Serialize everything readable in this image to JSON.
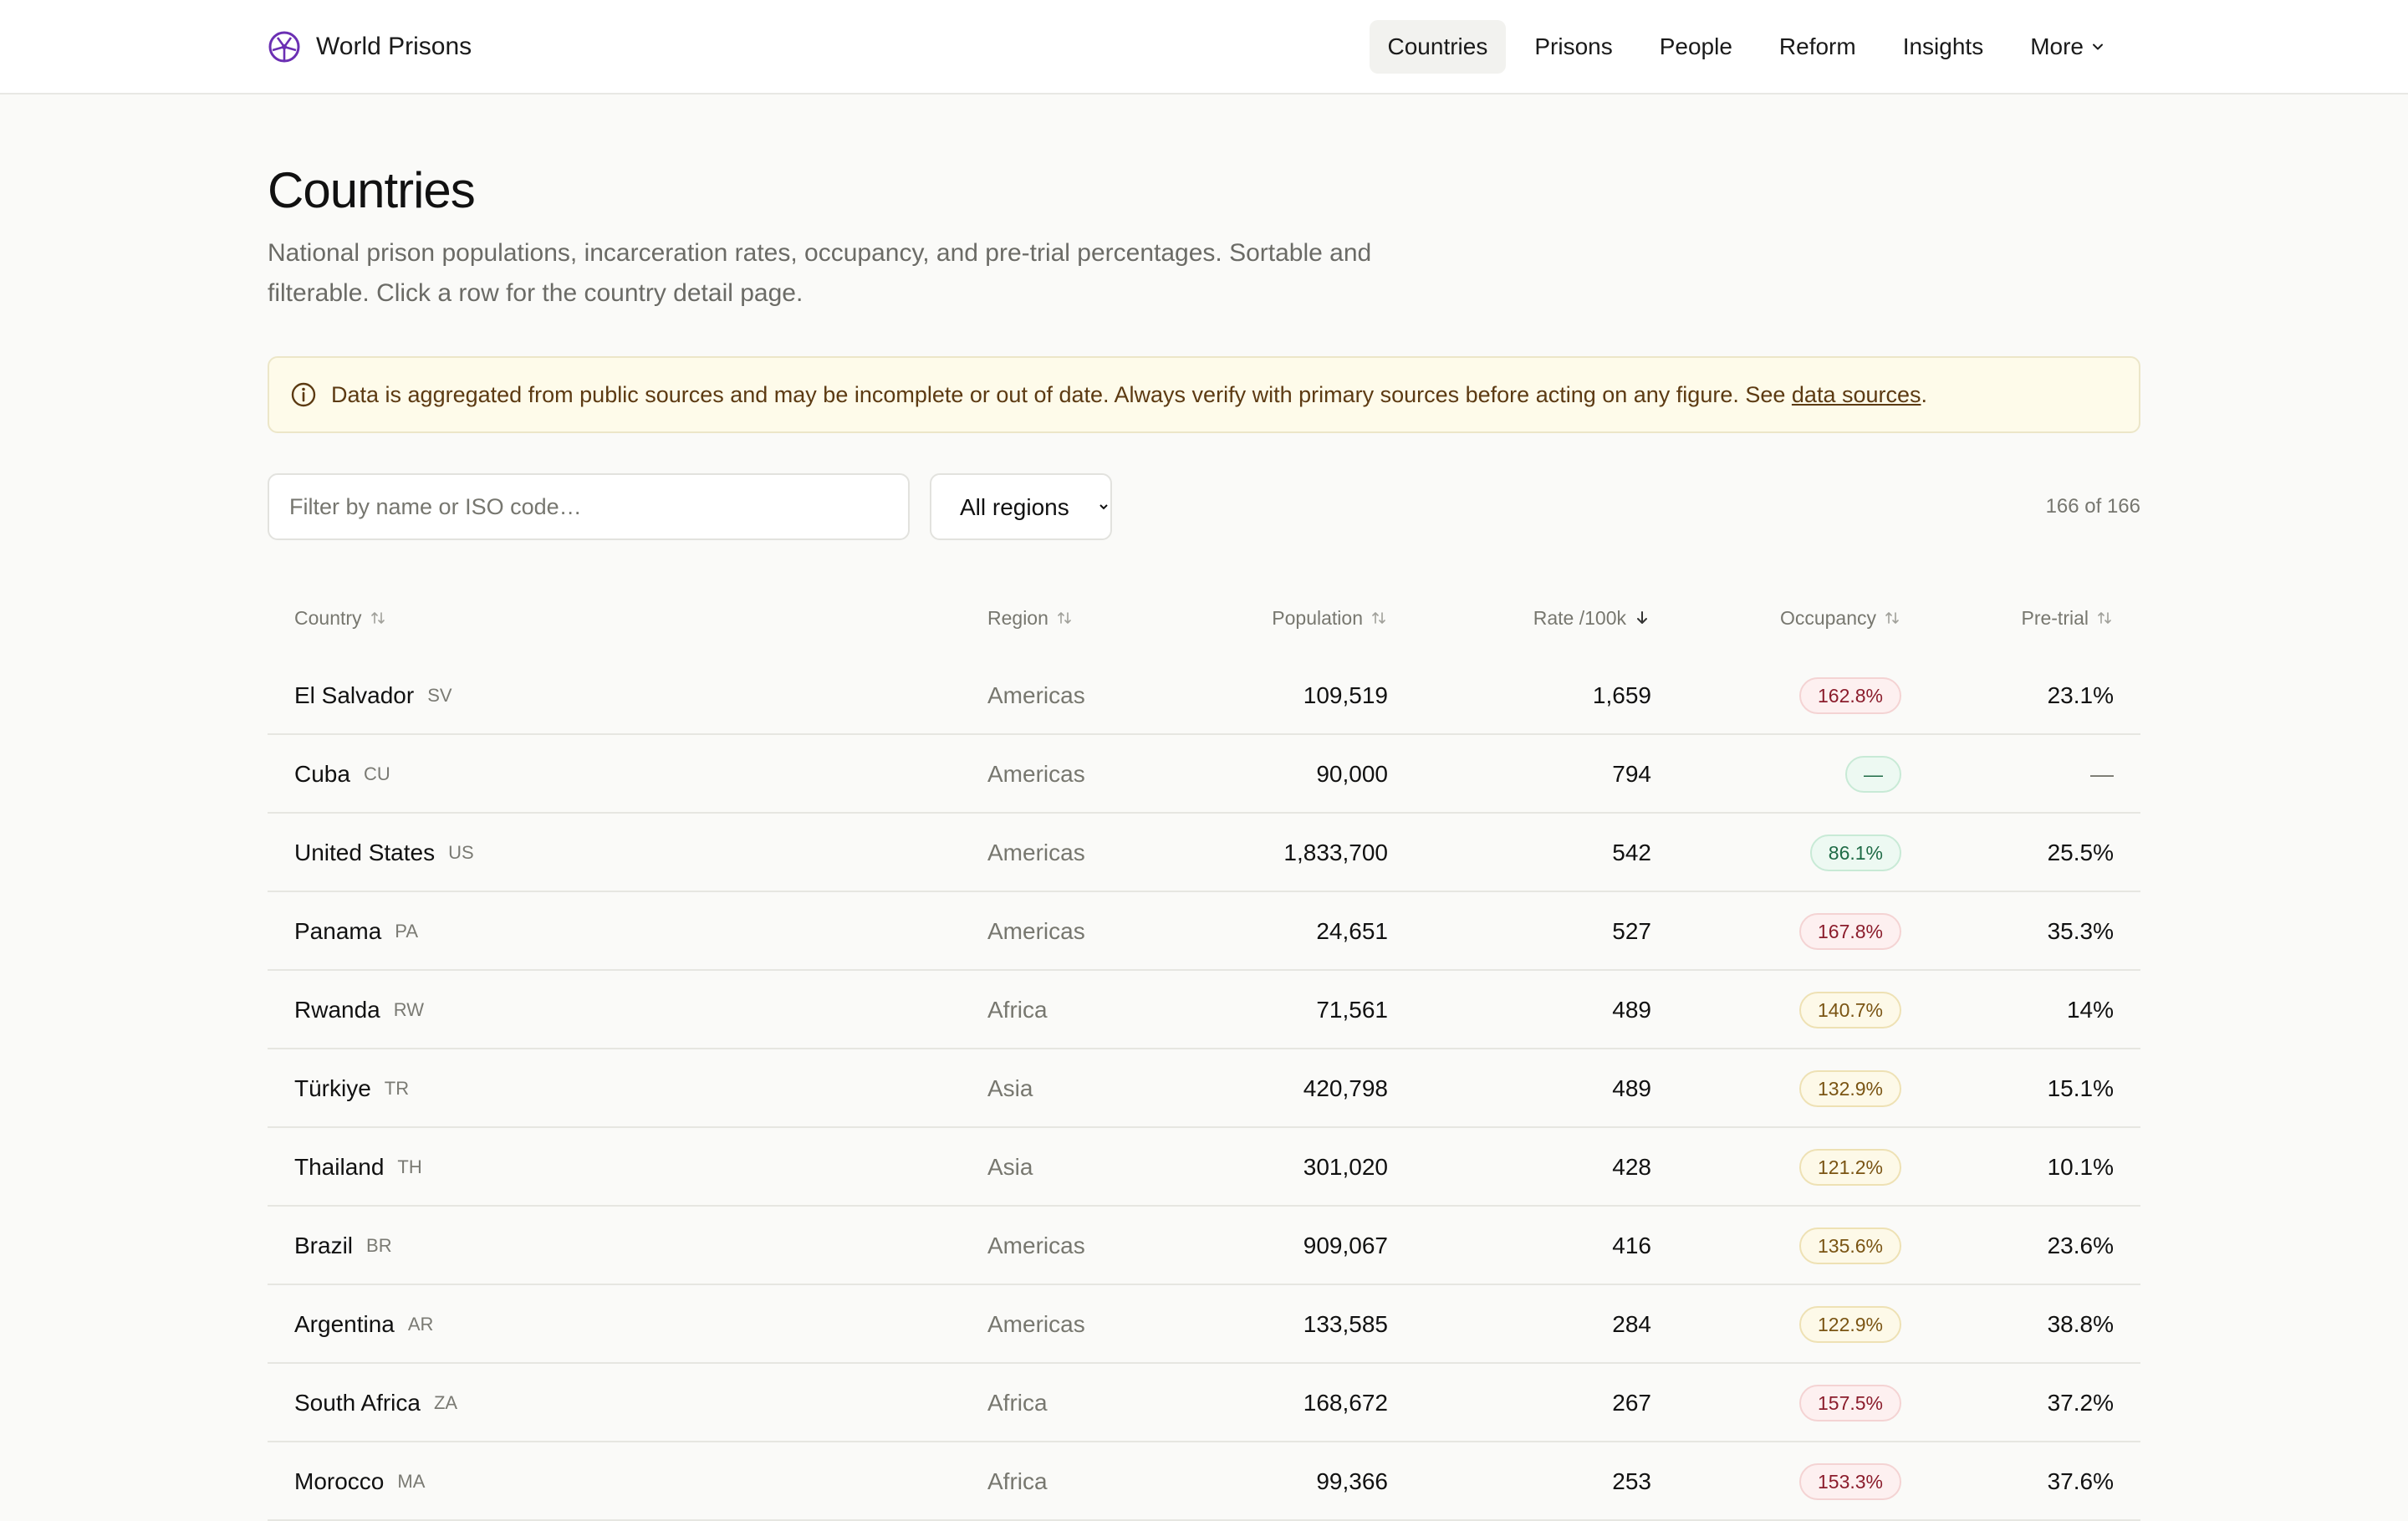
{
  "header": {
    "brand": "World Prisons",
    "nav": [
      {
        "label": "Countries",
        "active": true
      },
      {
        "label": "Prisons"
      },
      {
        "label": "People"
      },
      {
        "label": "Reform"
      },
      {
        "label": "Insights"
      },
      {
        "label": "More",
        "has_chevron": true
      }
    ]
  },
  "page": {
    "title": "Countries",
    "subtitle": "National prison populations, incarceration rates, occupancy, and pre-trial percentages. Sortable and filterable. Click a row for the country detail page."
  },
  "notice": {
    "text": "Data is aggregated from public sources and may be incomplete or out of date. Always verify with primary sources before acting on any figure. See ",
    "link": "data sources",
    "suffix": "."
  },
  "controls": {
    "filter_placeholder": "Filter by name or ISO code…",
    "region_selected": "All regions",
    "count": "166 of 166"
  },
  "table": {
    "columns": {
      "country": "Country",
      "region": "Region",
      "population": "Population",
      "rate": "Rate /100k",
      "occupancy": "Occupancy",
      "pretrial": "Pre-trial"
    },
    "rows": [
      {
        "country": "El Salvador",
        "iso": "SV",
        "region": "Americas",
        "population": "109,519",
        "rate": "1,659",
        "occupancy": "162.8%",
        "occ_level": "red",
        "pretrial": "23.1%"
      },
      {
        "country": "Cuba",
        "iso": "CU",
        "region": "Americas",
        "population": "90,000",
        "rate": "794",
        "occupancy": "—",
        "occ_level": "green",
        "pretrial": "—"
      },
      {
        "country": "United States",
        "iso": "US",
        "region": "Americas",
        "population": "1,833,700",
        "rate": "542",
        "occupancy": "86.1%",
        "occ_level": "green",
        "pretrial": "25.5%"
      },
      {
        "country": "Panama",
        "iso": "PA",
        "region": "Americas",
        "population": "24,651",
        "rate": "527",
        "occupancy": "167.8%",
        "occ_level": "red",
        "pretrial": "35.3%"
      },
      {
        "country": "Rwanda",
        "iso": "RW",
        "region": "Africa",
        "population": "71,561",
        "rate": "489",
        "occupancy": "140.7%",
        "occ_level": "amber",
        "pretrial": "14%"
      },
      {
        "country": "Türkiye",
        "iso": "TR",
        "region": "Asia",
        "population": "420,798",
        "rate": "489",
        "occupancy": "132.9%",
        "occ_level": "amber",
        "pretrial": "15.1%"
      },
      {
        "country": "Thailand",
        "iso": "TH",
        "region": "Asia",
        "population": "301,020",
        "rate": "428",
        "occupancy": "121.2%",
        "occ_level": "amber",
        "pretrial": "10.1%"
      },
      {
        "country": "Brazil",
        "iso": "BR",
        "region": "Americas",
        "population": "909,067",
        "rate": "416",
        "occupancy": "135.6%",
        "occ_level": "amber",
        "pretrial": "23.6%"
      },
      {
        "country": "Argentina",
        "iso": "AR",
        "region": "Americas",
        "population": "133,585",
        "rate": "284",
        "occupancy": "122.9%",
        "occ_level": "amber",
        "pretrial": "38.8%"
      },
      {
        "country": "South Africa",
        "iso": "ZA",
        "region": "Africa",
        "population": "168,672",
        "rate": "267",
        "occupancy": "157.5%",
        "occ_level": "red",
        "pretrial": "37.2%"
      },
      {
        "country": "Morocco",
        "iso": "MA",
        "region": "Africa",
        "population": "99,366",
        "rate": "253",
        "occupancy": "153.3%",
        "occ_level": "red",
        "pretrial": "37.6%"
      }
    ]
  },
  "colors": {
    "brand": "#6b2fb3",
    "notice_bg": "#fefbea",
    "badge_red": "#8b1d2c",
    "badge_amber": "#7a5413",
    "badge_green": "#1f6b46"
  }
}
